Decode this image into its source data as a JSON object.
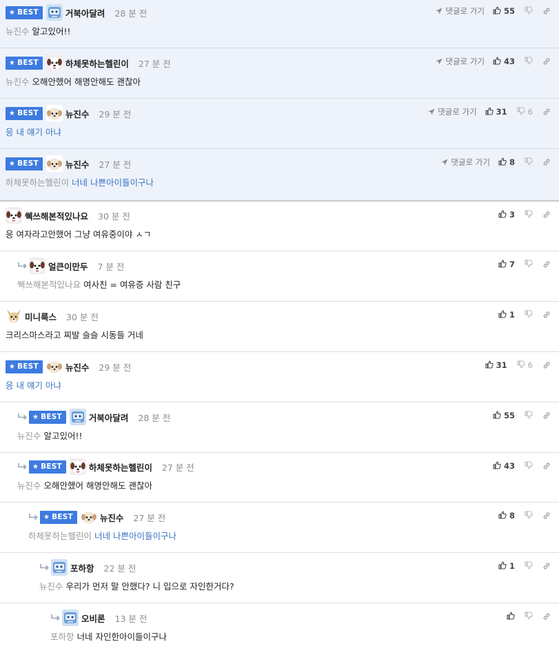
{
  "labels": {
    "best": "BEST",
    "goto": "댓글로 가기"
  },
  "colors": {
    "best_badge": "#3d7be0",
    "best_row_bg": "#eef3fb",
    "blue_text": "#3a72c4",
    "mention": "#999999"
  },
  "comments": [
    {
      "nick": "거북아달려",
      "time": "28 분 전",
      "mention": "뉴진수",
      "text": "알고있어!!",
      "likes": "55",
      "dislikes": "",
      "best": true,
      "goto": true,
      "avatar": "blue-robot-icon"
    },
    {
      "nick": "하체못하는헬린이",
      "time": "27 분 전",
      "mention": "뉴진수",
      "text": "오해안했어 해명안해도 괜찮아",
      "likes": "43",
      "dislikes": "",
      "best": true,
      "goto": true,
      "avatar": "dog-face-icon"
    },
    {
      "nick": "뉴진수",
      "time": "29 분 전",
      "mention": "",
      "text": "응 내 얘기 아냐",
      "likes": "31",
      "dislikes": "6",
      "best": true,
      "goto": true,
      "avatar": "puppy-icon"
    },
    {
      "nick": "뉴진수",
      "time": "27 분 전",
      "mention": "하체못하는헬린이",
      "text": "너네 나쁜아이들이구나",
      "likes": "8",
      "dislikes": "",
      "best": true,
      "goto": true,
      "avatar": "puppy-icon"
    },
    {
      "nick": "쒝쓰해본적있나요",
      "time": "30 분 전",
      "mention": "",
      "text": "응 여자라고안했어 그냥 여유중이야 ㅅㄱ",
      "likes": "3",
      "dislikes": "",
      "best": false,
      "goto": false,
      "avatar": "dog-face-icon"
    },
    {
      "nick": "얼큰이만두",
      "time": "7 분 전",
      "mention": "쒝쓰해본적있나요",
      "text": "여사친 = 여유증 사람 친구",
      "likes": "7",
      "dislikes": "",
      "best": false,
      "goto": false,
      "avatar": "dog-face-icon"
    },
    {
      "nick": "미니룩스",
      "time": "30 분 전",
      "mention": "",
      "text": "크리스마스라고 찌발 슬슬 시동들 거네",
      "likes": "1",
      "dislikes": "",
      "best": false,
      "goto": false,
      "avatar": "chihuahua-icon"
    },
    {
      "nick": "뉴진수",
      "time": "29 분 전",
      "mention": "",
      "text": "응 내 얘기 아냐",
      "likes": "31",
      "dislikes": "6",
      "best": true,
      "goto": false,
      "avatar": "puppy-icon"
    },
    {
      "nick": "거북아달려",
      "time": "28 분 전",
      "mention": "뉴진수",
      "text": "알고있어!!",
      "likes": "55",
      "dislikes": "",
      "best": true,
      "goto": false,
      "avatar": "blue-robot-icon"
    },
    {
      "nick": "하체못하는헬린이",
      "time": "27 분 전",
      "mention": "뉴진수",
      "text": "오해안했어 해명안해도 괜찮아",
      "likes": "43",
      "dislikes": "",
      "best": true,
      "goto": false,
      "avatar": "dog-face-icon"
    },
    {
      "nick": "뉴진수",
      "time": "27 분 전",
      "mention": "하체못하는헬린이",
      "text": "너네 나쁜아이들이구나",
      "likes": "8",
      "dislikes": "",
      "best": true,
      "goto": false,
      "avatar": "puppy-icon"
    },
    {
      "nick": "포하항",
      "time": "22 분 전",
      "mention": "뉴진수",
      "text": "우리가 먼저 말 안했다? 니 입으로 자인한거다?",
      "likes": "1",
      "dislikes": "",
      "best": false,
      "goto": false,
      "avatar": "blue-robot-icon"
    },
    {
      "nick": "오비론",
      "time": "13 분 전",
      "mention": "포하항",
      "text": "너네 자인한아이들이구나",
      "likes": "",
      "dislikes": "",
      "best": false,
      "goto": false,
      "avatar": "blue-robot-icon"
    }
  ]
}
